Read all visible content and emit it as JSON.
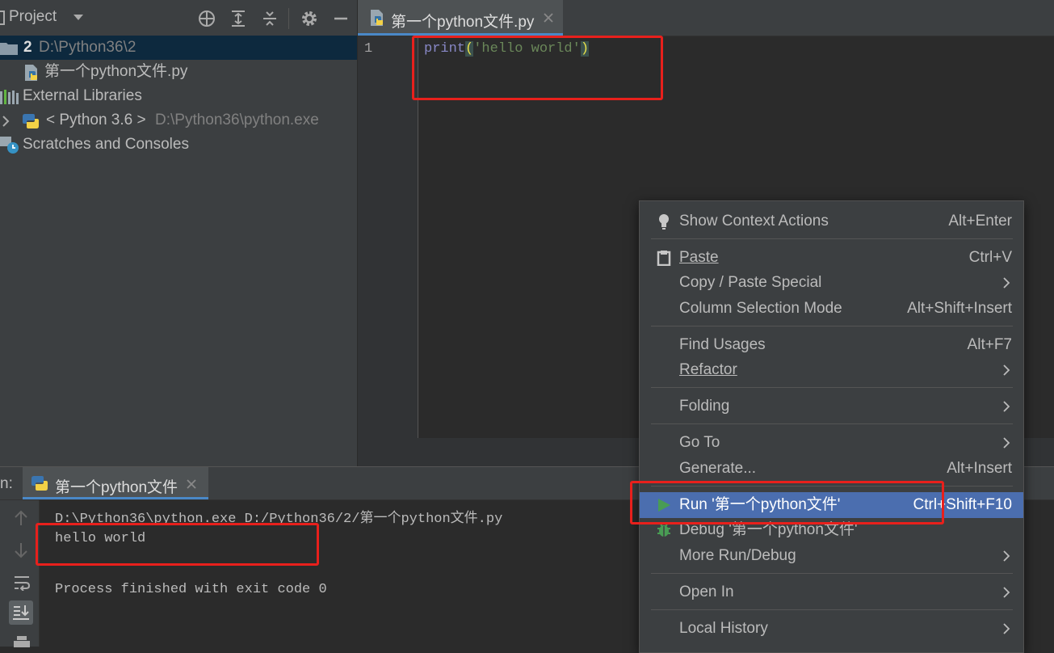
{
  "project_panel": {
    "title": "Project",
    "tree": [
      {
        "name": "2",
        "path": "D:\\Python36\\2"
      },
      {
        "name": "第一个python文件.py"
      },
      {
        "name": "External Libraries"
      },
      {
        "name": "< Python 3.6 >",
        "path": "D:\\Python36\\python.exe"
      },
      {
        "name": "Scratches and Consoles"
      }
    ]
  },
  "editor": {
    "tab_label": "第一个python文件.py",
    "line_number": "1",
    "code": {
      "func": "print",
      "open": "(",
      "string": "'hello world'",
      "close": ")"
    }
  },
  "run_panel": {
    "label": "n:",
    "tab_label": "第一个python文件",
    "console": [
      "D:\\Python36\\python.exe D:/Python36/2/第一个python文件.py",
      "hello world",
      "",
      "Process finished with exit code 0"
    ]
  },
  "context_menu": {
    "items": [
      {
        "label": "Show Context Actions",
        "shortcut": "Alt+Enter"
      },
      {
        "label": "Paste",
        "shortcut": "Ctrl+V"
      },
      {
        "label": "Copy / Paste Special",
        "shortcut": ""
      },
      {
        "label": "Column Selection Mode",
        "shortcut": "Alt+Shift+Insert"
      },
      {
        "label": "Find Usages",
        "shortcut": "Alt+F7"
      },
      {
        "label": "Refactor",
        "shortcut": ""
      },
      {
        "label": "Folding",
        "shortcut": ""
      },
      {
        "label": "Go To",
        "shortcut": ""
      },
      {
        "label": "Generate...",
        "shortcut": "Alt+Insert"
      },
      {
        "label": "Run '第一个python文件'",
        "shortcut": "Ctrl+Shift+F10"
      },
      {
        "label": "Debug '第一个python文件'",
        "shortcut": ""
      },
      {
        "label": "More Run/Debug",
        "shortcut": ""
      },
      {
        "label": "Open In",
        "shortcut": ""
      },
      {
        "label": "Local History",
        "shortcut": ""
      }
    ]
  },
  "colors": {
    "accent": "#4b6eaf",
    "highlight_box": "#e8201c",
    "keyword": "#cc7832",
    "function": "#8888c6",
    "string": "#6a8759",
    "run_green": "#499c54"
  }
}
